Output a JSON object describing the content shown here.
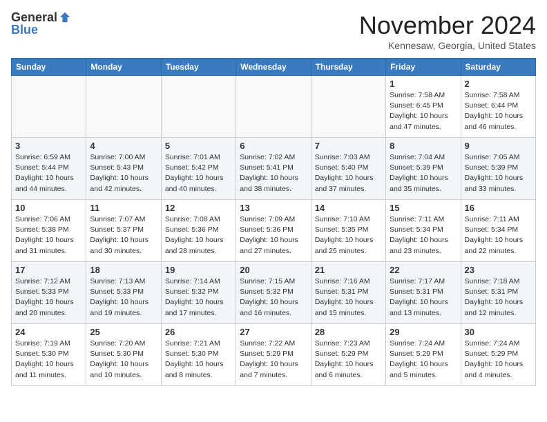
{
  "header": {
    "logo_general": "General",
    "logo_blue": "Blue",
    "month": "November 2024",
    "location": "Kennesaw, Georgia, United States"
  },
  "weekdays": [
    "Sunday",
    "Monday",
    "Tuesday",
    "Wednesday",
    "Thursday",
    "Friday",
    "Saturday"
  ],
  "weeks": [
    [
      {
        "day": "",
        "info": ""
      },
      {
        "day": "",
        "info": ""
      },
      {
        "day": "",
        "info": ""
      },
      {
        "day": "",
        "info": ""
      },
      {
        "day": "",
        "info": ""
      },
      {
        "day": "1",
        "info": "Sunrise: 7:58 AM\nSunset: 6:45 PM\nDaylight: 10 hours\nand 47 minutes."
      },
      {
        "day": "2",
        "info": "Sunrise: 7:58 AM\nSunset: 6:44 PM\nDaylight: 10 hours\nand 46 minutes."
      }
    ],
    [
      {
        "day": "3",
        "info": "Sunrise: 6:59 AM\nSunset: 5:44 PM\nDaylight: 10 hours\nand 44 minutes."
      },
      {
        "day": "4",
        "info": "Sunrise: 7:00 AM\nSunset: 5:43 PM\nDaylight: 10 hours\nand 42 minutes."
      },
      {
        "day": "5",
        "info": "Sunrise: 7:01 AM\nSunset: 5:42 PM\nDaylight: 10 hours\nand 40 minutes."
      },
      {
        "day": "6",
        "info": "Sunrise: 7:02 AM\nSunset: 5:41 PM\nDaylight: 10 hours\nand 38 minutes."
      },
      {
        "day": "7",
        "info": "Sunrise: 7:03 AM\nSunset: 5:40 PM\nDaylight: 10 hours\nand 37 minutes."
      },
      {
        "day": "8",
        "info": "Sunrise: 7:04 AM\nSunset: 5:39 PM\nDaylight: 10 hours\nand 35 minutes."
      },
      {
        "day": "9",
        "info": "Sunrise: 7:05 AM\nSunset: 5:39 PM\nDaylight: 10 hours\nand 33 minutes."
      }
    ],
    [
      {
        "day": "10",
        "info": "Sunrise: 7:06 AM\nSunset: 5:38 PM\nDaylight: 10 hours\nand 31 minutes."
      },
      {
        "day": "11",
        "info": "Sunrise: 7:07 AM\nSunset: 5:37 PM\nDaylight: 10 hours\nand 30 minutes."
      },
      {
        "day": "12",
        "info": "Sunrise: 7:08 AM\nSunset: 5:36 PM\nDaylight: 10 hours\nand 28 minutes."
      },
      {
        "day": "13",
        "info": "Sunrise: 7:09 AM\nSunset: 5:36 PM\nDaylight: 10 hours\nand 27 minutes."
      },
      {
        "day": "14",
        "info": "Sunrise: 7:10 AM\nSunset: 5:35 PM\nDaylight: 10 hours\nand 25 minutes."
      },
      {
        "day": "15",
        "info": "Sunrise: 7:11 AM\nSunset: 5:34 PM\nDaylight: 10 hours\nand 23 minutes."
      },
      {
        "day": "16",
        "info": "Sunrise: 7:11 AM\nSunset: 5:34 PM\nDaylight: 10 hours\nand 22 minutes."
      }
    ],
    [
      {
        "day": "17",
        "info": "Sunrise: 7:12 AM\nSunset: 5:33 PM\nDaylight: 10 hours\nand 20 minutes."
      },
      {
        "day": "18",
        "info": "Sunrise: 7:13 AM\nSunset: 5:33 PM\nDaylight: 10 hours\nand 19 minutes."
      },
      {
        "day": "19",
        "info": "Sunrise: 7:14 AM\nSunset: 5:32 PM\nDaylight: 10 hours\nand 17 minutes."
      },
      {
        "day": "20",
        "info": "Sunrise: 7:15 AM\nSunset: 5:32 PM\nDaylight: 10 hours\nand 16 minutes."
      },
      {
        "day": "21",
        "info": "Sunrise: 7:16 AM\nSunset: 5:31 PM\nDaylight: 10 hours\nand 15 minutes."
      },
      {
        "day": "22",
        "info": "Sunrise: 7:17 AM\nSunset: 5:31 PM\nDaylight: 10 hours\nand 13 minutes."
      },
      {
        "day": "23",
        "info": "Sunrise: 7:18 AM\nSunset: 5:31 PM\nDaylight: 10 hours\nand 12 minutes."
      }
    ],
    [
      {
        "day": "24",
        "info": "Sunrise: 7:19 AM\nSunset: 5:30 PM\nDaylight: 10 hours\nand 11 minutes."
      },
      {
        "day": "25",
        "info": "Sunrise: 7:20 AM\nSunset: 5:30 PM\nDaylight: 10 hours\nand 10 minutes."
      },
      {
        "day": "26",
        "info": "Sunrise: 7:21 AM\nSunset: 5:30 PM\nDaylight: 10 hours\nand 8 minutes."
      },
      {
        "day": "27",
        "info": "Sunrise: 7:22 AM\nSunset: 5:29 PM\nDaylight: 10 hours\nand 7 minutes."
      },
      {
        "day": "28",
        "info": "Sunrise: 7:23 AM\nSunset: 5:29 PM\nDaylight: 10 hours\nand 6 minutes."
      },
      {
        "day": "29",
        "info": "Sunrise: 7:24 AM\nSunset: 5:29 PM\nDaylight: 10 hours\nand 5 minutes."
      },
      {
        "day": "30",
        "info": "Sunrise: 7:24 AM\nSunset: 5:29 PM\nDaylight: 10 hours\nand 4 minutes."
      }
    ]
  ]
}
